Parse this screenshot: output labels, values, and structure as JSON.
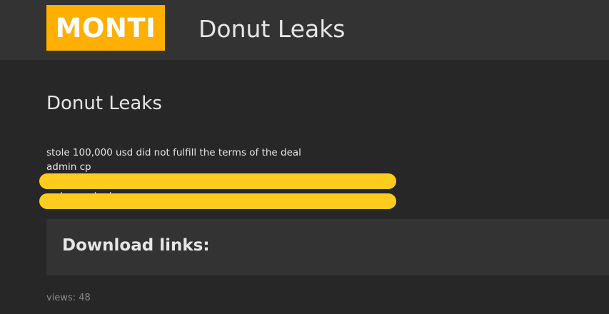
{
  "header": {
    "logo_text": "MONTI",
    "site_title": "Donut Leaks"
  },
  "post": {
    "title": "Donut Leaks",
    "lines": [
      "stole 100,000 usd did not fulfill the terms of the deal",
      "admin cp",
      "web cp url ad m"
    ],
    "download_heading": "Download links:",
    "views": "views: 48"
  },
  "colors": {
    "logo_background": "#ffaf00",
    "header_background": "#333333",
    "page_background": "#272727",
    "redaction_marker": "#ffcc1d"
  }
}
